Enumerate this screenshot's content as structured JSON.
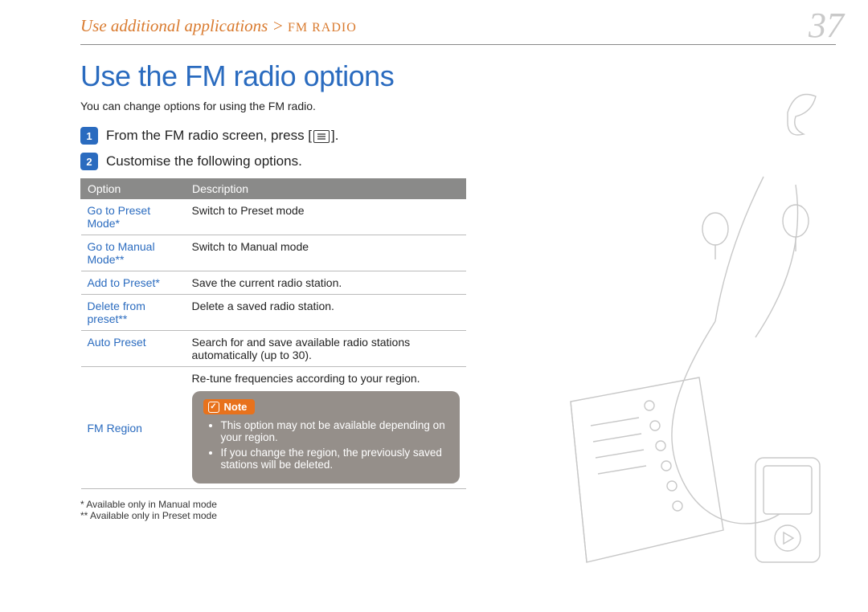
{
  "breadcrumb": {
    "main": "Use additional applications",
    "sep": ">",
    "sub": "FM RADIO"
  },
  "pageNumber": "37",
  "title": "Use the FM radio options",
  "lead": "You can change options for using the FM radio.",
  "steps": [
    {
      "num": "1",
      "text_before": "From the FM radio screen, press [",
      "text_after": "]."
    },
    {
      "num": "2",
      "text_full": "Customise the following options."
    }
  ],
  "table": {
    "headers": {
      "option": "Option",
      "description": "Description"
    },
    "rows": [
      {
        "option": "Go to Preset Mode*",
        "description": "Switch to Preset mode"
      },
      {
        "option": "Go to Manual Mode**",
        "description": "Switch to Manual mode"
      },
      {
        "option": "Add to Preset*",
        "description": "Save the current radio station."
      },
      {
        "option": "Delete from preset**",
        "description": "Delete a saved radio station."
      },
      {
        "option": "Auto Preset",
        "description": "Search for and save available radio stations automatically (up to 30)."
      },
      {
        "option": "FM Region",
        "description": "Re-tune frequencies according to your region."
      }
    ]
  },
  "note": {
    "label": "Note",
    "items": [
      "This option may not be available depending on your region.",
      "If you change the region, the previously saved stations will be deleted."
    ]
  },
  "footnotes": [
    "*   Available only in Manual mode",
    "** Available only in Preset mode"
  ]
}
